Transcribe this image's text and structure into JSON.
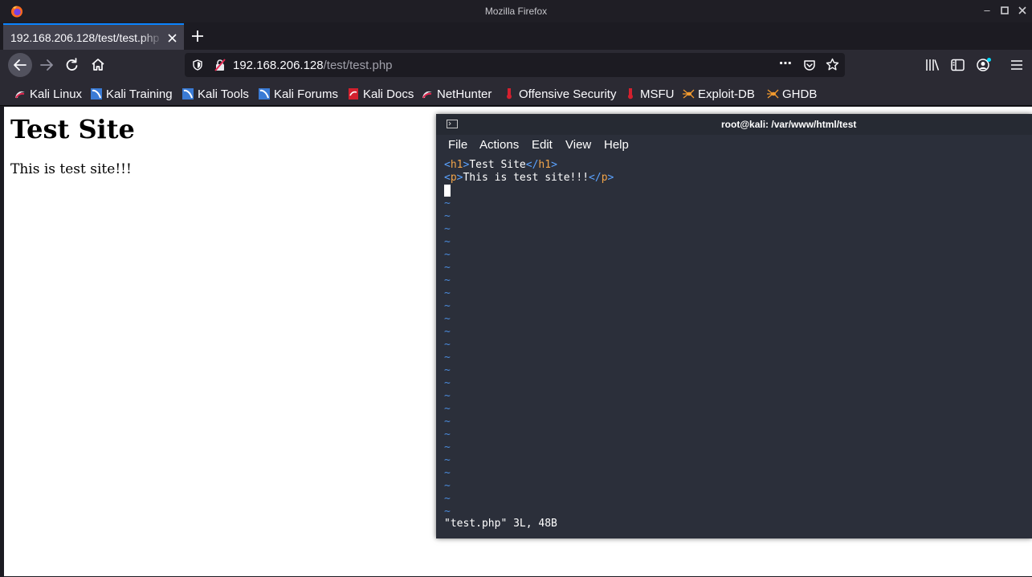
{
  "window": {
    "title": "Mozilla Firefox",
    "controls": [
      "minimize-icon",
      "maximize-icon",
      "close-icon"
    ]
  },
  "tab": {
    "label": "192.168.206.128/test/test.php",
    "close_icon": "close-icon"
  },
  "urlbar": {
    "host": "192.168.206.128",
    "path": "/test/test.php"
  },
  "bookmarks": [
    {
      "label": "Kali Linux",
      "icon": "kali-icon"
    },
    {
      "label": "Kali Training",
      "icon": "kali-training-icon"
    },
    {
      "label": "Kali Tools",
      "icon": "kali-tools-icon"
    },
    {
      "label": "Kali Forums",
      "icon": "kali-forums-icon"
    },
    {
      "label": "Kali Docs",
      "icon": "kali-docs-icon"
    },
    {
      "label": "NetHunter",
      "icon": "nethunter-icon"
    },
    {
      "label": "Offensive Security",
      "icon": "offsec-icon"
    },
    {
      "label": "MSFU",
      "icon": "msfu-icon"
    },
    {
      "label": "Exploit-DB",
      "icon": "exploitdb-icon"
    },
    {
      "label": "GHDB",
      "icon": "ghdb-icon"
    }
  ],
  "page": {
    "heading": "Test Site",
    "paragraph": "This is test site!!!"
  },
  "terminal": {
    "title": "root@kali: /var/www/html/test",
    "menu": [
      "File",
      "Actions",
      "Edit",
      "View",
      "Help"
    ],
    "lines": [
      {
        "open_lt": "<",
        "open_tag": "h1",
        "open_gt": ">",
        "text": "Test Site",
        "close_lt": "</",
        "close_tag": "h1",
        "close_gt": ">"
      },
      {
        "open_lt": "<",
        "open_tag": "p",
        "open_gt": ">",
        "text": "This is test site!!!",
        "close_lt": "</",
        "close_tag": "p",
        "close_gt": ">"
      }
    ],
    "tilde": "~",
    "status": "\"test.php\" 3L, 48B"
  },
  "colors": {
    "accent": "#0a84ff",
    "tag": "#5ba3ff",
    "tag_name": "#f0a44a",
    "tilde": "#4a89d8"
  }
}
